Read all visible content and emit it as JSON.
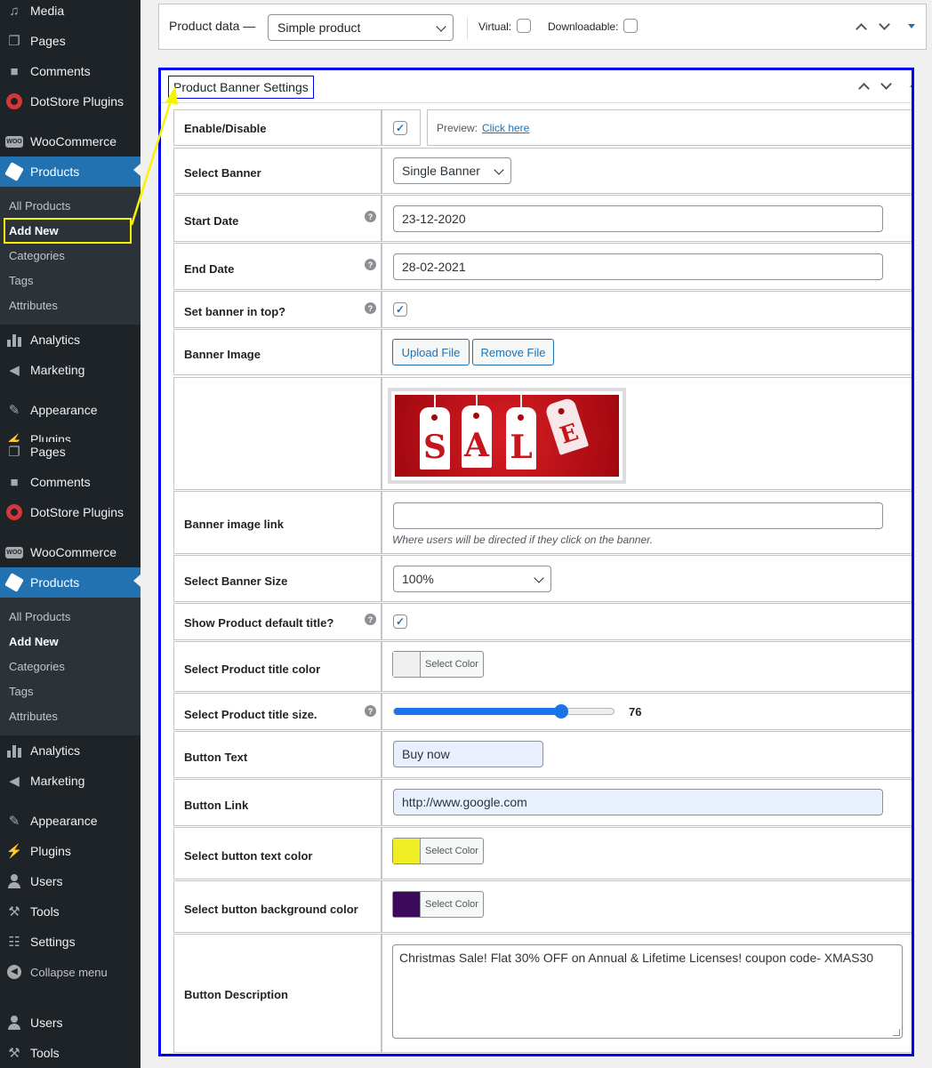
{
  "sidebar": {
    "items": [
      {
        "label": "Media"
      },
      {
        "label": "Pages"
      },
      {
        "label": "Comments"
      },
      {
        "label": "DotStore Plugins"
      },
      {
        "label": "WooCommerce"
      },
      {
        "label": "Products"
      },
      {
        "label": "Analytics"
      },
      {
        "label": "Marketing"
      },
      {
        "label": "Appearance"
      },
      {
        "label": "Plugins"
      },
      {
        "label": "Pages"
      },
      {
        "label": "Comments"
      },
      {
        "label": "DotStore Plugins"
      },
      {
        "label": "WooCommerce"
      },
      {
        "label": "Products"
      },
      {
        "label": "Analytics"
      },
      {
        "label": "Marketing"
      },
      {
        "label": "Appearance"
      },
      {
        "label": "Plugins"
      },
      {
        "label": "Users"
      },
      {
        "label": "Tools"
      },
      {
        "label": "Settings"
      },
      {
        "label": "Collapse menu"
      },
      {
        "label": "Users"
      },
      {
        "label": "Tools"
      }
    ],
    "sub1": [
      "All Products",
      "Add New",
      "Categories",
      "Tags",
      "Attributes"
    ],
    "sub2": [
      "All Products",
      "Add New",
      "Categories",
      "Tags",
      "Attributes"
    ],
    "woo_badge": "WOO"
  },
  "product_data": {
    "title": "Product data —",
    "type_value": "Simple product",
    "virtual_label": "Virtual:",
    "downloadable_label": "Downloadable:"
  },
  "banner": {
    "title": "Product Banner Settings",
    "rows": {
      "enable": {
        "label": "Enable/Disable",
        "checked": true,
        "preview_label": "Preview:",
        "preview_link": "Click here"
      },
      "select_banner": {
        "label": "Select Banner",
        "value": "Single Banner"
      },
      "start_date": {
        "label": "Start Date",
        "value": "23-12-2020"
      },
      "end_date": {
        "label": "End Date",
        "value": "28-02-2021"
      },
      "top": {
        "label": "Set banner in top?",
        "checked": true
      },
      "image": {
        "label": "Banner Image",
        "upload": "Upload File",
        "remove": "Remove File"
      },
      "image_preview": {
        "tags": [
          "S",
          "A",
          "L",
          "E"
        ]
      },
      "image_link": {
        "label": "Banner image link",
        "value": "",
        "description": "Where users will be directed if they click on the banner."
      },
      "size": {
        "label": "Select Banner Size",
        "value": "100%"
      },
      "show_title": {
        "label": "Show Product default title?",
        "checked": true
      },
      "title_color": {
        "label": "Select Product title color",
        "picker_label": "Select Color",
        "color": "#f0f0f1"
      },
      "title_size": {
        "label": "Select Product title size.",
        "value": "76",
        "fraction": 0.76
      },
      "button_text": {
        "label": "Button Text",
        "value": "Buy now"
      },
      "button_link": {
        "label": "Button Link",
        "value": "http://www.google.com"
      },
      "button_text_color": {
        "label": "Select button text color",
        "picker_label": "Select Color",
        "color": "#eeee22"
      },
      "button_bg_color": {
        "label": "Select button background color",
        "picker_label": "Select Color",
        "color": "#3c0a5a"
      },
      "description": {
        "label": "Button Description",
        "value": "Christmas Sale! Flat 30% OFF on Annual & Lifetime Licenses! coupon code- XMAS30"
      }
    },
    "help_glyph": "?",
    "check_glyph": "✓"
  },
  "colors": {
    "accent": "#2271b1",
    "annotation_box": "#0000ee",
    "annotation_highlight": "#f5f500"
  }
}
